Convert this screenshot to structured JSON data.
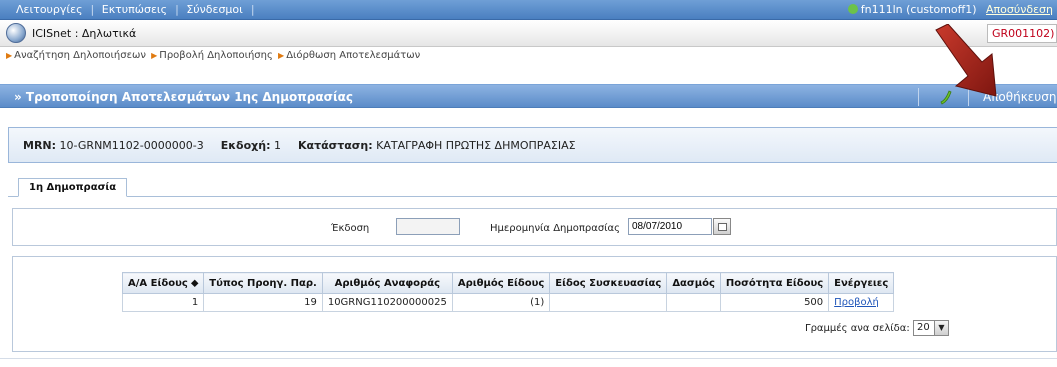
{
  "menu": {
    "items": [
      "Λειτουργίες",
      "Εκτυπώσεις",
      "Σύνδεσμοι"
    ],
    "user": "fn111ln (customoff1)",
    "logout": "Αποσύνδεση"
  },
  "app": {
    "title": "ICISnet : Δηλωτικά",
    "code": "GR001102)"
  },
  "breadcrumb": [
    "Αναζήτηση Δηλοποιήσεων",
    "Προβολή Δηλοποιήσης",
    "Διόρθωση Αποτελεσμάτων"
  ],
  "page": {
    "title": "» Τροποποίηση Αποτελεσμάτων 1ης Δημοπρασίας",
    "save_label": "Αποθήκευση"
  },
  "info": {
    "mrn_label": "MRN:",
    "mrn_value": "10-GRNM1102-0000000-3",
    "version_label": "Εκδοχή:",
    "version_value": "1",
    "status_label": "Κατάσταση:",
    "status_value": "ΚΑΤΑΓΡΑΦΗ ΠΡΩΤΗΣ ΔΗΜΟΠΡΑΣΙΑΣ"
  },
  "tabs": [
    {
      "label": "1η Δημοπρασία"
    }
  ],
  "filters": {
    "edition_label": "Έκδοση",
    "edition_value": "",
    "date_label": "Ημερομηνία Δημοπρασίας",
    "date_value": "08/07/2010"
  },
  "table": {
    "columns": [
      "Α/Α Είδους ⬥",
      "Τύπος Προηγ. Παρ.",
      "Αριθμός Αναφοράς",
      "Αριθμός Είδους",
      "Είδος Συσκευασίας",
      "Δασμός",
      "Ποσότητα Είδους",
      "Ενέργειες"
    ],
    "rows": [
      {
        "aa": "1",
        "type": "19",
        "ref": "10GRNG110200000025",
        "item_no": "(1)",
        "pkg": "",
        "duty": "",
        "qty": "500",
        "action": "Προβολή"
      }
    ]
  },
  "pager": {
    "label": "Γραμμές ανα σελίδα:",
    "value": "20"
  },
  "colors": {
    "menu_bar": "#4a7fc0",
    "title_bar": "#5b8cc9",
    "code_red": "#c0001a",
    "arrow_red": "#a8221a"
  }
}
